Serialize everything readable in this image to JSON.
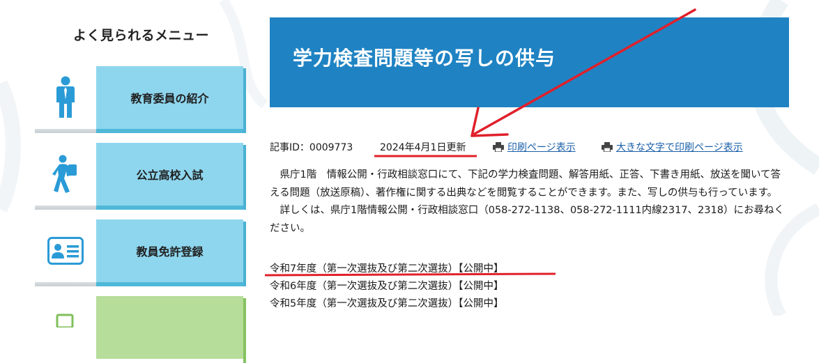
{
  "sidebar": {
    "title": "よく見られるメニュー",
    "items": [
      {
        "label": "教育委員の紹介",
        "icon": "person-icon"
      },
      {
        "label": "公立高校入試",
        "icon": "student-walking-icon"
      },
      {
        "label": "教員免許登録",
        "icon": "id-card-icon"
      },
      {
        "label": "",
        "icon": "document-icon"
      }
    ]
  },
  "main": {
    "title": "学力検査問題等の写しの供与",
    "meta": {
      "article_id": "記事ID：0009773",
      "updated": "2024年4月1日更新",
      "print_link": "印刷ページ表示",
      "print_large_link": "大きな文字で印刷ページ表示"
    },
    "paragraphs": [
      "　県庁1階　情報公開・行政相談窓口にて、下記の学力検査問題、解答用紙、正答、下書き用紙、放送を聞いて答える問題（放送原稿）、著作権に関する出典などを閲覧することができます。また、写しの供与も行っています。",
      "　詳しくは、県庁1階情報公開・行政相談窓口（058-272-1138、058-272-1111内線2317、2318）にお尋ねください。"
    ],
    "years": [
      "令和7年度（第一次選抜及び第二次選抜）【公開中】",
      "令和6年度（第一次選抜及び第二次選抜）【公開中】",
      "令和5年度（第一次選抜及び第二次選抜）【公開中】"
    ]
  },
  "colors": {
    "banner": "#1f83c3",
    "menu_blue": "#8ed6ee",
    "menu_green": "#b6dd9a",
    "link": "#1a5fa8",
    "annotation_red": "#e0202a"
  }
}
